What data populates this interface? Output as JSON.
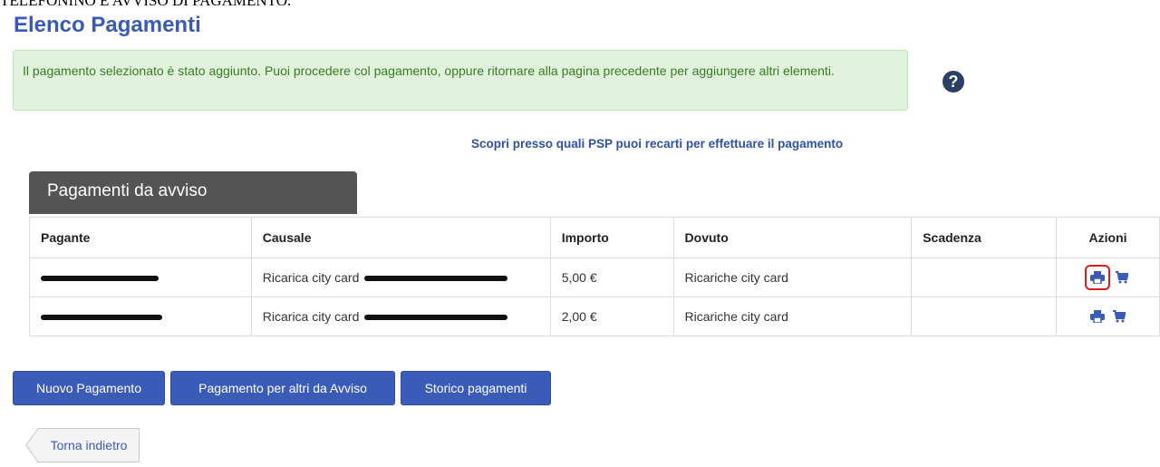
{
  "top_cut_text": "TELEFONINO E AVVISO DI PAGAMENTO.",
  "page_title": "Elenco Pagamenti",
  "alert_message": "Il pagamento selezionato è stato aggiunto. Puoi procedere col pagamento, oppure ritornare alla pagina precedente per aggiungere altri elementi.",
  "help_icon": {
    "name": "question-circle-icon",
    "glyph": "?"
  },
  "psp_link": "Scopri presso quali PSP puoi recarti per effettuare il pagamento",
  "section_title": "Pagamenti da avviso",
  "table": {
    "headers": [
      "Pagante",
      "Causale",
      "Importo",
      "Dovuto",
      "Scadenza",
      "Azioni"
    ],
    "rows": [
      {
        "pagante": "",
        "causale": "Ricarica city card",
        "importo": "5,00 €",
        "dovuto": "Ricariche city card",
        "scadenza": "",
        "print_highlighted": true
      },
      {
        "pagante": "",
        "causale": "Ricarica city card",
        "importo": "2,00 €",
        "dovuto": "Ricariche city card",
        "scadenza": "",
        "print_highlighted": false
      }
    ]
  },
  "buttons": {
    "new_payment": "Nuovo Pagamento",
    "pay_for_others": "Pagamento per altri da Avviso",
    "history": "Storico pagamenti"
  },
  "back_button": "Torna indietro",
  "colors": {
    "primary": "#3b5bb8",
    "title": "#3a5ab5",
    "alert_bg": "#e1f2dc",
    "alert_text": "#3a7a27",
    "tab_bg": "#545454",
    "highlight": "#e01b1b"
  }
}
